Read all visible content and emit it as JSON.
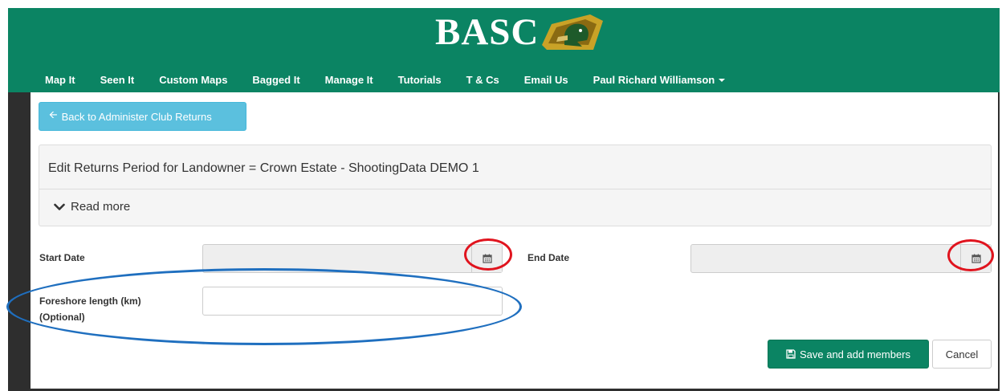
{
  "brand": {
    "name": "BASC",
    "logo_icon": "duck-head-icon"
  },
  "nav": {
    "items": [
      {
        "label": "Map It"
      },
      {
        "label": "Seen It"
      },
      {
        "label": "Custom Maps"
      },
      {
        "label": "Bagged It"
      },
      {
        "label": "Manage It"
      },
      {
        "label": "Tutorials"
      },
      {
        "label": "T & Cs"
      },
      {
        "label": "Email Us"
      }
    ],
    "user_menu": {
      "label": "Paul Richard Williamson",
      "icon": "caret-down-icon"
    }
  },
  "back_button": {
    "label": "Back to Administer Club Returns",
    "icon": "arrow-left-icon"
  },
  "panel": {
    "title": "Edit Returns Period for Landowner = Crown Estate - ShootingData DEMO 1",
    "read_more": "Read more",
    "read_more_icon": "chevron-down-icon"
  },
  "form": {
    "start_date": {
      "label": "Start Date",
      "value": "",
      "icon": "calendar-icon"
    },
    "end_date": {
      "label": "End Date",
      "value": "",
      "icon": "calendar-icon"
    },
    "foreshore": {
      "label_line1": "Foreshore length (km)",
      "label_line2": "(Optional)",
      "value": ""
    }
  },
  "actions": {
    "save_label": "Save and add members",
    "save_icon": "floppy-disk-icon",
    "cancel_label": "Cancel"
  },
  "colors": {
    "brand_green": "#0b8463",
    "info_blue": "#5bc0de",
    "highlight_red": "#e0141e",
    "highlight_blue": "#1f6fbf"
  }
}
